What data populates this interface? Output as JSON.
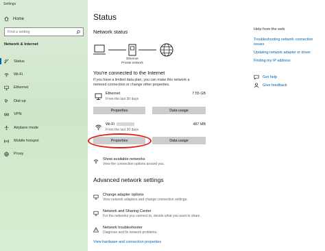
{
  "window": {
    "title": "Settings"
  },
  "sidebar": {
    "home_label": "Home",
    "search_placeholder": "Find a setting",
    "section_title": "Network & Internet",
    "items": [
      {
        "label": "Status",
        "icon": "status-icon",
        "active": true
      },
      {
        "label": "Wi-Fi",
        "icon": "wifi-icon"
      },
      {
        "label": "Ethernet",
        "icon": "ethernet-icon"
      },
      {
        "label": "Dial-up",
        "icon": "dialup-icon"
      },
      {
        "label": "VPN",
        "icon": "vpn-icon"
      },
      {
        "label": "Airplane mode",
        "icon": "airplane-icon"
      },
      {
        "label": "Mobile hotspot",
        "icon": "hotspot-icon"
      },
      {
        "label": "Proxy",
        "icon": "proxy-icon"
      }
    ]
  },
  "main": {
    "title": "Status",
    "network_status": "Network status",
    "diagram": {
      "middle_label_1": "Ethernet",
      "middle_label_2": "Private network"
    },
    "connected_heading": "You're connected to the Internet",
    "explain_text": "If you have a limited data plan, you can make this network a metered connection or change other properties.",
    "connections": [
      {
        "name": "Ethernet",
        "period": "From the last 30 days",
        "size": "7.55 GB",
        "properties_label": "Properties",
        "data_usage_label": "Data usage"
      },
      {
        "name": "Wi-Fi",
        "period": "From the last 30 days",
        "size": "487 MB",
        "properties_label": "Properties",
        "data_usage_label": "Data usage"
      }
    ],
    "show_networks": {
      "title": "Show available networks",
      "sub": "View the connection options around you."
    },
    "advanced_heading": "Advanced network settings",
    "advanced": [
      {
        "title": "Change adapter options",
        "sub": "View network adapters and change connection settings."
      },
      {
        "title": "Network and Sharing Center",
        "sub": "For the networks you connect to, decide what you want to share."
      },
      {
        "title": "Network troubleshooter",
        "sub": "Diagnose and fix network problems."
      }
    ],
    "bottom_link": "View hardware and connection properties"
  },
  "right": {
    "help_title": "Help from the web",
    "links": [
      "Troubleshooting network connection issues",
      "Updating network adapter or driver",
      "Finding my IP address"
    ],
    "get_help": "Get help",
    "give_feedback": "Give feedback"
  },
  "colors": {
    "accent": "#0063b1",
    "highlight": "#e21b10",
    "sidebar": "#d3e8cd"
  }
}
